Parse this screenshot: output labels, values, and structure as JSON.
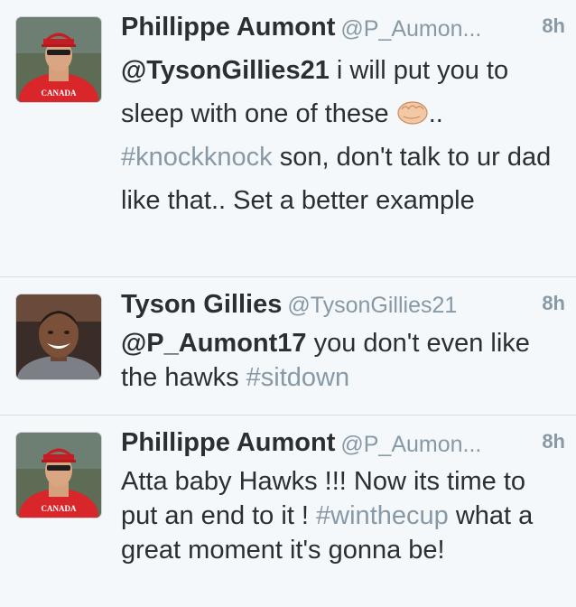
{
  "tweets": [
    {
      "name": "Phillippe Aumont",
      "handle": "@P_Aumon...",
      "time": "8h",
      "mention": "@TysonGillies21",
      "text_a": " i will put you to sleep with one of these ",
      "emoji": "fist-emoji",
      "text_b": "..",
      "hashtag": "#knockknock",
      "text_c": " son, don't talk to ur dad like that.. Set a better example",
      "avatar_label": "CANADA"
    },
    {
      "name": "Tyson Gillies",
      "handle": "@TysonGillies21",
      "time": "8h",
      "mention": "@P_Aumont17",
      "text_a": " you don't even like the hawks ",
      "hashtag": "#sitdown"
    },
    {
      "name": "Phillippe Aumont",
      "handle": "@P_Aumon...",
      "time": "8h",
      "text_a": "Atta baby Hawks !!! Now its time to put an end to it ! ",
      "hashtag": "#winthecup",
      "text_b": " what a great moment it's gonna be!",
      "avatar_label": "CANADA"
    }
  ]
}
